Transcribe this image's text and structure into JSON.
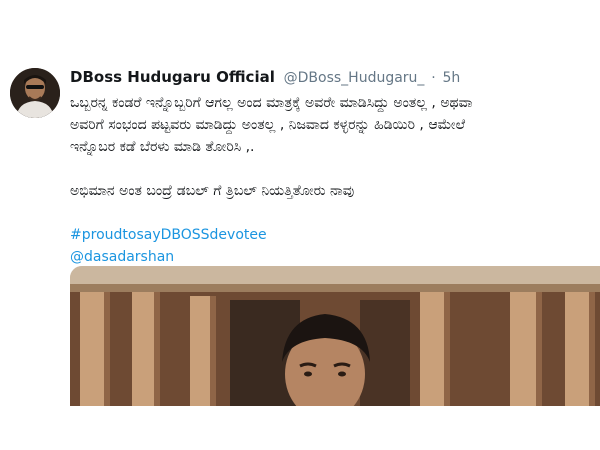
{
  "tweet": {
    "display_name": "DBoss Hudugaru Official",
    "handle": "@DBoss_Hudugaru_",
    "separator": "·",
    "time": "5h",
    "body_line_1": "ಒಬ್ಬರನ್ನ ಕಂಡರೆ ಇನ್ನೊಬ್ಬರಿಗೆ ಆಗಲ್ಲ ಅಂದ ಮಾತ್ರಕ್ಕೆ ಅವರೇ ಮಾಡಿಸಿದ್ದು ಅಂತಲ್ಲ ,  ಅಥವಾ",
    "body_line_2": "ಅವರಿಗೆ ಸಂಭಂದ ಪಟ್ಟವರು ಮಾಡಿದ್ದು ಅಂತಲ್ಲ , ನಿಜವಾದ ಕಳ್ಳರನ್ನು ಹಿಡಿಯಿರಿ , ಆಮೇಲೆ",
    "body_line_3": "ಇನ್ನೊಬರ ಕಡೆ ಬೆರಳು ಮಾಡಿ ತೋರಿಸಿ ,.",
    "body_line_4": "ಅಭಿಮಾನ ಅಂತ ಬಂದ್ರೆ ಡಬಲ್ ಗೆ  ತ್ರಿಬಲ್ ನಿಯತ್ತಿತೋರು ನಾವು",
    "hashtag": "#proudtosayDBOSSdevotee",
    "mention": "@dasadarshan"
  },
  "colors": {
    "link": "#1b95e0",
    "secondary_text": "#657786",
    "primary_text": "#14171a"
  },
  "icons": {
    "avatar": "profile-photo"
  }
}
